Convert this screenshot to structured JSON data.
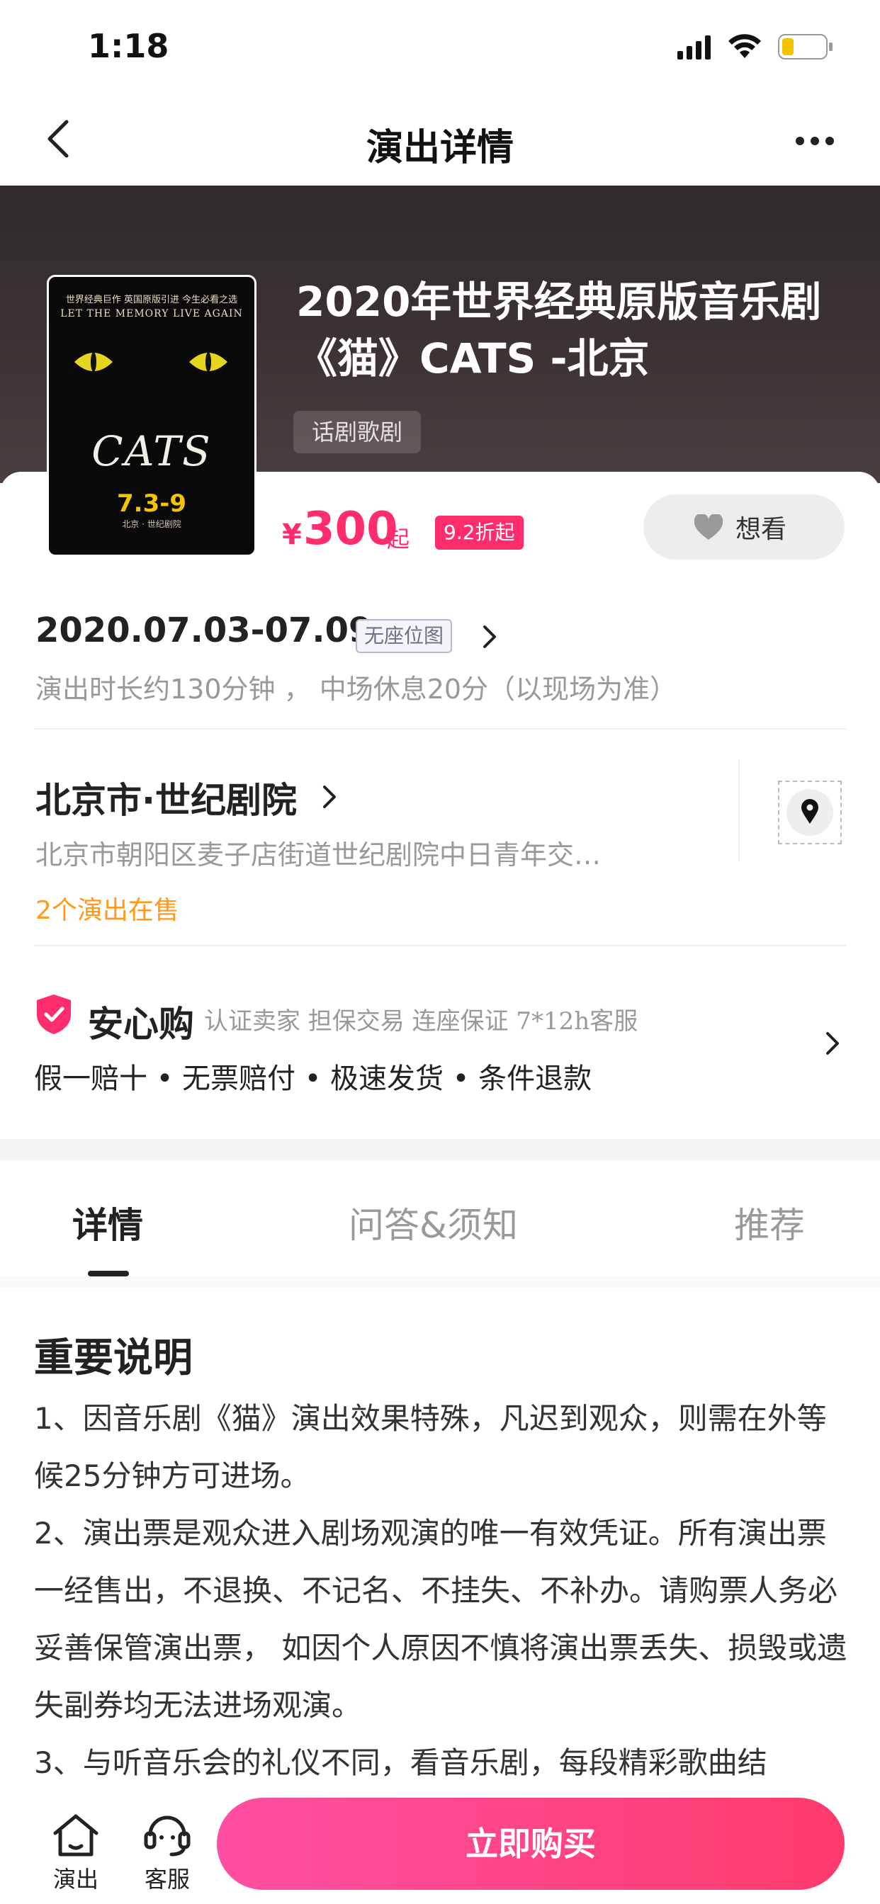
{
  "status_bar": {
    "time": "1:18"
  },
  "nav": {
    "title": "演出详情"
  },
  "show": {
    "title": "2020年世界经典原版音乐剧《猫》CATS -北京",
    "category": "话剧歌剧",
    "poster": {
      "tagline_top": "世界经典巨作  英国原版引进  今生必看之选",
      "tagline_en": "LET THE MEMORY LIVE AGAIN",
      "logo": "CATS",
      "dates": "7.3-9",
      "venue_line": "北京 · 世纪剧院"
    }
  },
  "price": {
    "symbol": "¥",
    "value": "300",
    "suffix": "起",
    "discount": "9.2折起"
  },
  "want_button": {
    "label": "想看"
  },
  "schedule": {
    "date_range": "2020.07.03-07.09",
    "seat_tag": "无座位图",
    "duration": "演出时长约130分钟 ， 中场休息20分（以现场为准）"
  },
  "venue": {
    "name": "北京市·世纪剧院",
    "address": "北京市朝阳区麦子店街道世纪剧院中日青年交…",
    "on_sale": "2个演出在售"
  },
  "assurance": {
    "title": "安心购",
    "desc": "认证卖家 担保交易 连座保证 7*12h客服",
    "items": "假一赔十 • 无票赔付 • 极速发货 • 条件退款"
  },
  "tabs": [
    {
      "label": "详情",
      "active": true
    },
    {
      "label": "问答&须知",
      "active": false
    },
    {
      "label": "推荐",
      "active": false
    }
  ],
  "notice": {
    "title": "重要说明",
    "paragraphs": [
      "1、因音乐剧《猫》演出效果特殊，凡迟到观众，则需在外等候25分钟方可进场。",
      "2、演出票是观众进入剧场观演的唯一有效凭证。所有演出票一经售出，不退换、不记名、不挂失、不补办。请购票人务必妥善保管演出票， 如因个人原因不慎将演出票丢失、损毁或遗失副券均无法进场观演。",
      "3、与听音乐会的礼仪不同，看音乐剧，每段精彩歌曲结"
    ]
  },
  "bottom_bar": {
    "home_label": "演出",
    "service_label": "客服",
    "buy_label": "立即购买"
  },
  "colors": {
    "accent": "#ff2d6c",
    "buy_gradient_start": "#ff4fa3",
    "buy_gradient_end": "#ff3b6c",
    "on_sale": "#ff9a1a",
    "hero_bg": "#3e3435"
  }
}
